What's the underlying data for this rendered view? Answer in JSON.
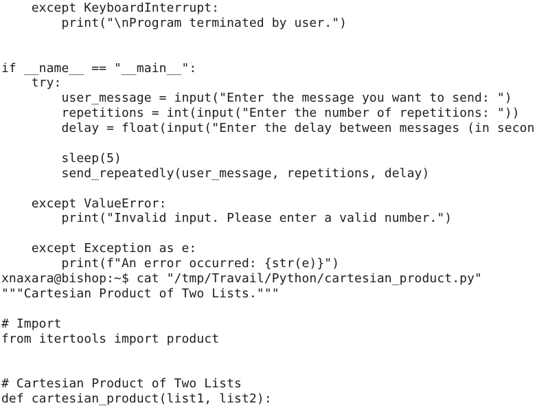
{
  "terminal": {
    "lines": [
      "    except KeyboardInterrupt:",
      "        print(\"\\nProgram terminated by user.\")",
      "",
      "",
      "if __name__ == \"__main__\":",
      "    try:",
      "        user_message = input(\"Enter the message you want to send: \")",
      "        repetitions = int(input(\"Enter the number of repetitions: \"))",
      "        delay = float(input(\"Enter the delay between messages (in secon",
      "",
      "        sleep(5)",
      "        send_repeatedly(user_message, repetitions, delay)",
      "",
      "    except ValueError:",
      "        print(\"Invalid input. Please enter a valid number.\")",
      "",
      "    except Exception as e:",
      "        print(f\"An error occurred: {str(e)}\")",
      "xnaxara@bishop:~$ cat \"/tmp/Travail/Python/cartesian_product.py\"",
      "\"\"\"Cartesian Product of Two Lists.\"\"\"",
      "",
      "# Import",
      "from itertools import product",
      "",
      "",
      "# Cartesian Product of Two Lists",
      "def cartesian_product(list1, list2):"
    ]
  }
}
